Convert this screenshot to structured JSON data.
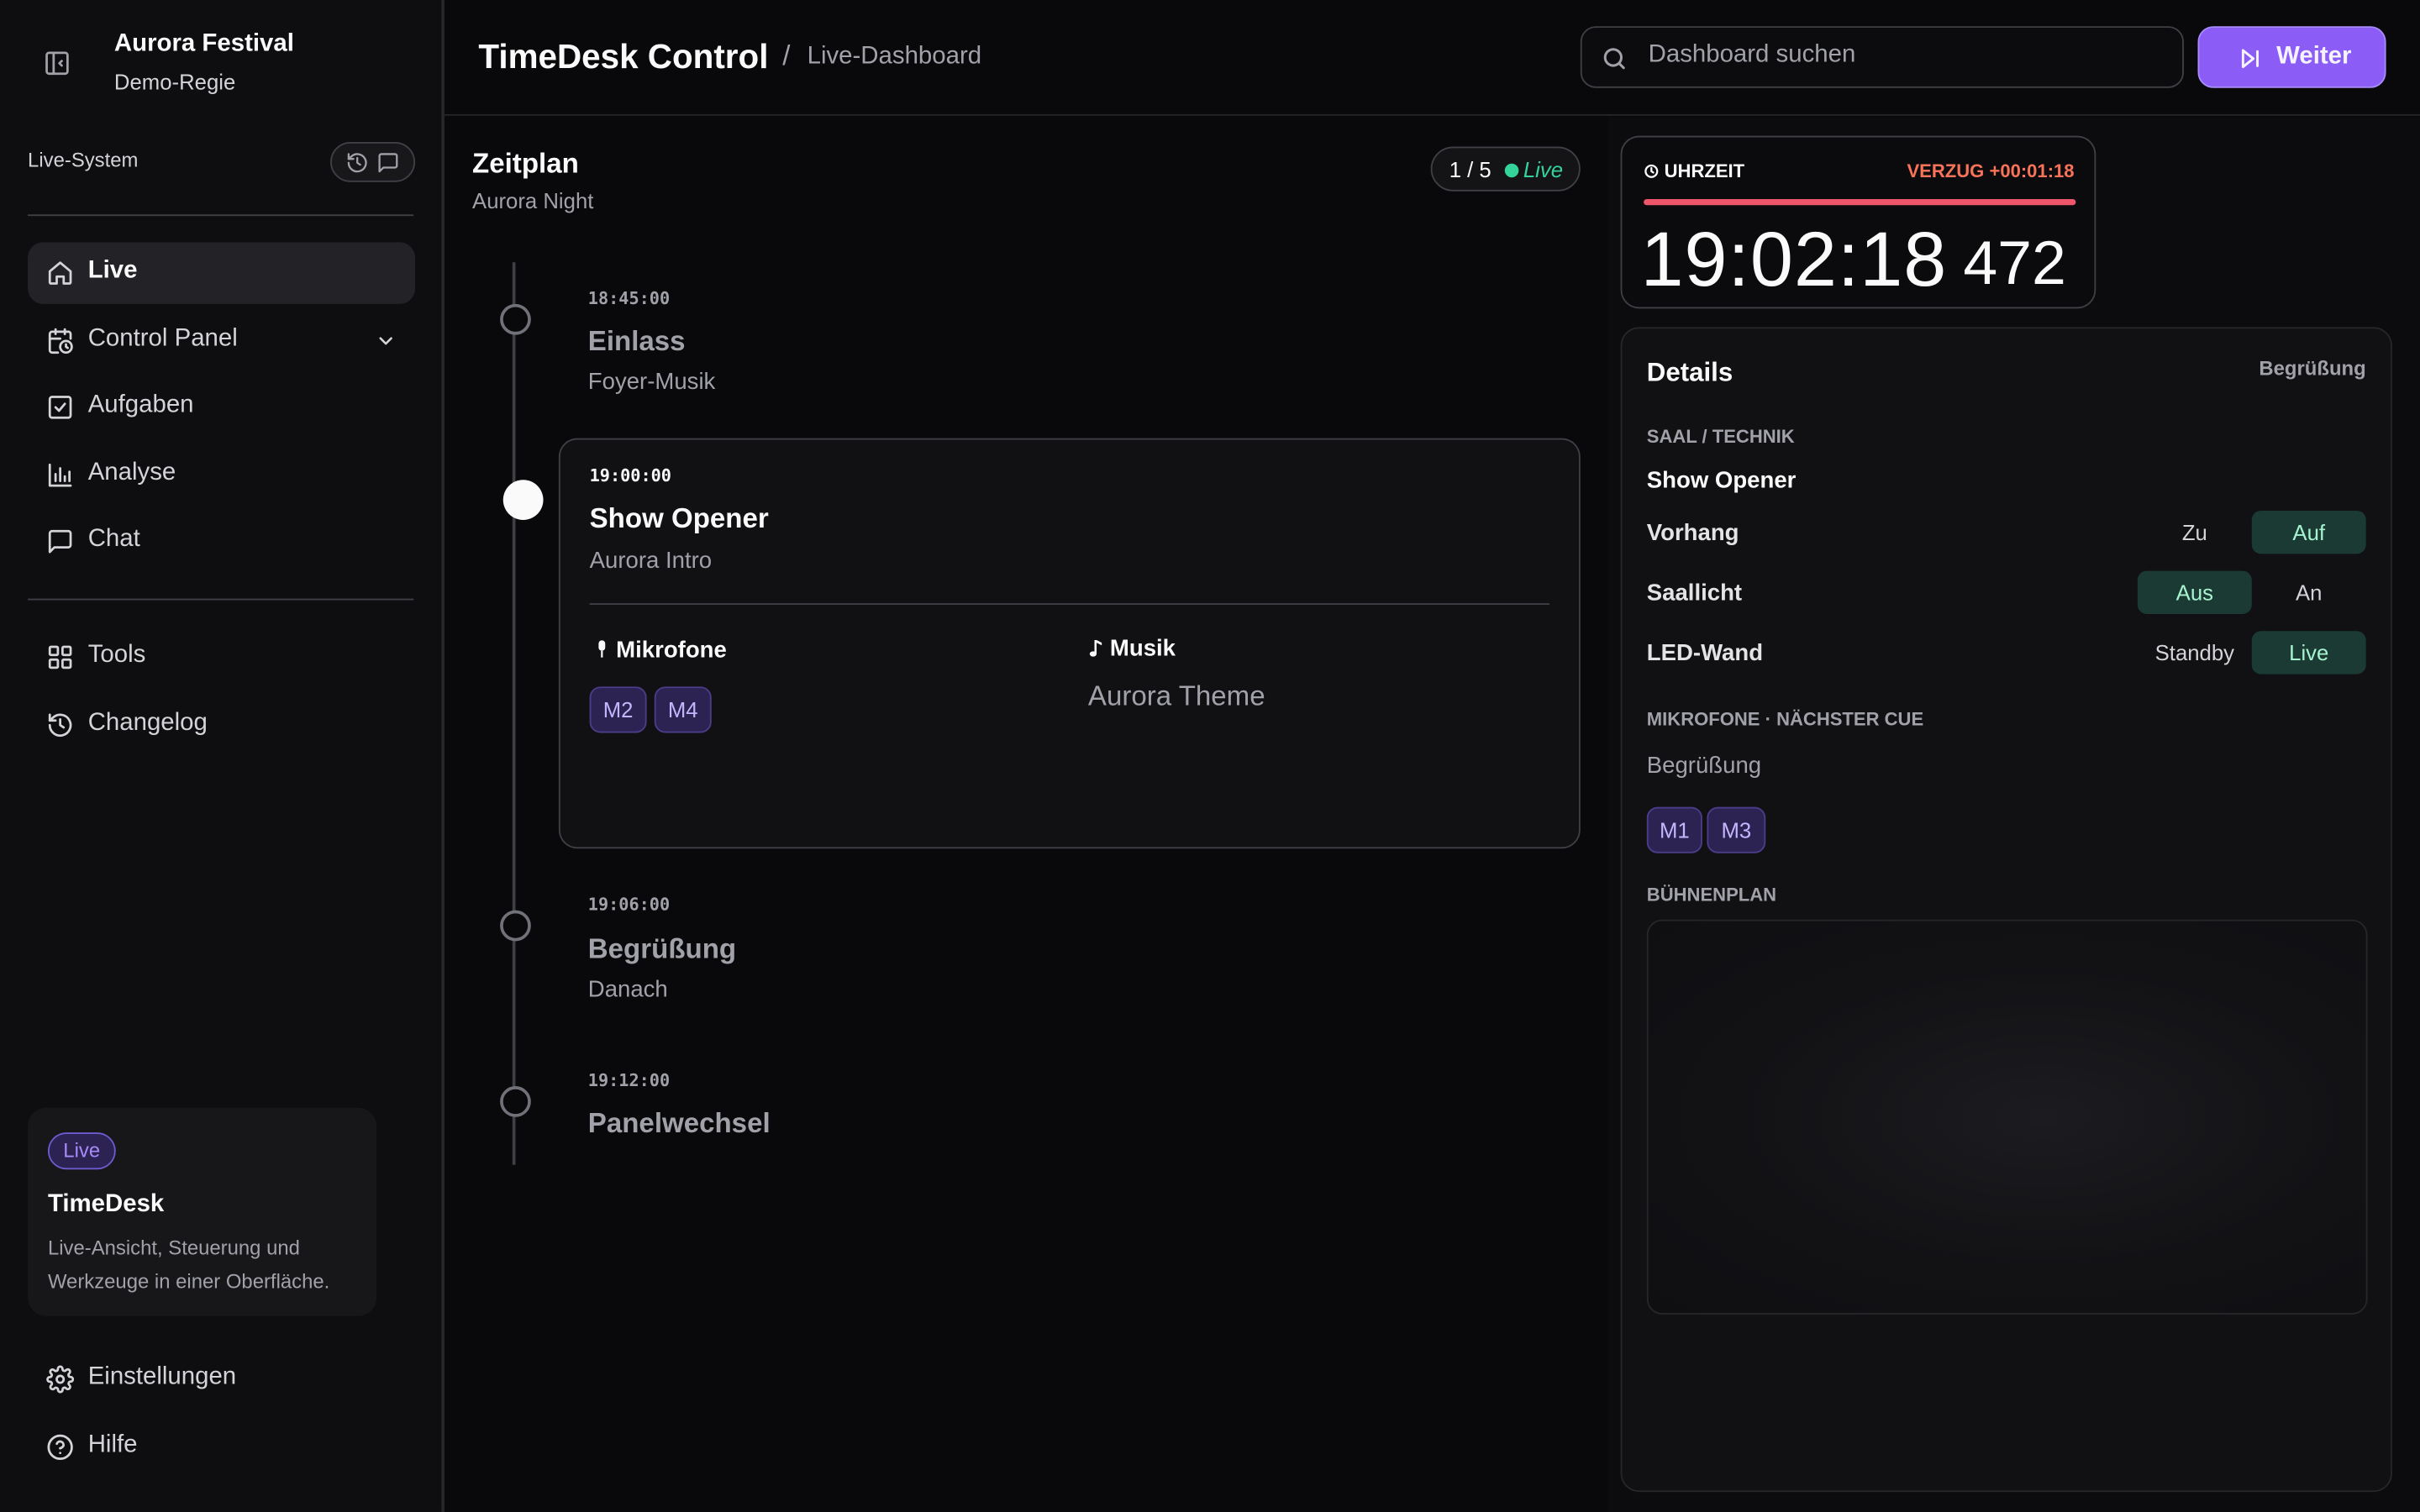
{
  "sidebar": {
    "brand": {
      "title": "Aurora Festival",
      "subtitle": "Demo-Regie"
    },
    "system_label": "Live-System",
    "nav_primary": [
      {
        "label": "Live",
        "icon": "home-icon",
        "active": true
      },
      {
        "label": "Control Panel",
        "icon": "calendar-clock-icon",
        "active": false
      },
      {
        "label": "Aufgaben",
        "icon": "check-square-icon",
        "active": false
      },
      {
        "label": "Analyse",
        "icon": "bar-chart-icon",
        "active": false
      },
      {
        "label": "Chat",
        "icon": "chat-icon",
        "active": false
      }
    ],
    "nav_secondary": [
      {
        "label": "Tools",
        "icon": "grid-icon"
      },
      {
        "label": "Changelog",
        "icon": "history-icon"
      }
    ],
    "promo": {
      "badge": "Live",
      "title": "TimeDesk",
      "text": "Live-Ansicht, Steuerung und Werkzeuge in einer Oberfläche."
    },
    "nav_footer": [
      {
        "label": "Einstellungen",
        "icon": "gear-icon"
      },
      {
        "label": "Hilfe",
        "icon": "help-circle-icon"
      }
    ]
  },
  "header": {
    "title": "TimeDesk Control",
    "separator": "/",
    "breadcrumb": "Live-Dashboard",
    "search_placeholder": "Dashboard suchen",
    "next_button": "Weiter",
    "accent_color": "#8b5cf6"
  },
  "schedule": {
    "title": "Zeitplan",
    "subtitle": "Aurora Night",
    "counter": "1 / 5",
    "status": "Live",
    "events": [
      {
        "time": "18:45:00",
        "name": "Einlass",
        "sub": "Foyer-Musik"
      },
      {
        "time": "19:00:00",
        "name": "Show Opener",
        "sub": "Aurora Intro",
        "current": true,
        "mics_label": "Mikrofone",
        "mics": [
          "M2",
          "M4"
        ],
        "music_label": "Musik",
        "music": "Aurora Theme"
      },
      {
        "time": "19:06:00",
        "name": "Begrüßung",
        "sub": "Danach"
      },
      {
        "time": "19:12:00",
        "name": "Panelwechsel",
        "sub": ""
      }
    ]
  },
  "clock": {
    "label": "UHRZEIT",
    "delay": "VERZUG +00:01:18",
    "time": "19:02:18",
    "ms": "472",
    "delay_color": "#f97359"
  },
  "details": {
    "title": "Details",
    "tag": "Begrüßung",
    "section_hall": "SAAL / TECHNIK",
    "cue_name": "Show Opener",
    "rows": [
      {
        "label": "Vorhang",
        "opt_a": "Zu",
        "opt_b": "Auf",
        "selected": "b"
      },
      {
        "label": "Saallicht",
        "opt_a": "Aus",
        "opt_b": "An",
        "selected": "a"
      },
      {
        "label": "LED-Wand",
        "opt_a": "Standby",
        "opt_b": "Live",
        "selected": "b"
      }
    ],
    "section_mics": "MIKROFONE · NÄCHSTER CUE",
    "next_cue": "Begrüßung",
    "next_mics": [
      "M1",
      "M3"
    ],
    "section_stage": "BÜHNENPLAN"
  }
}
